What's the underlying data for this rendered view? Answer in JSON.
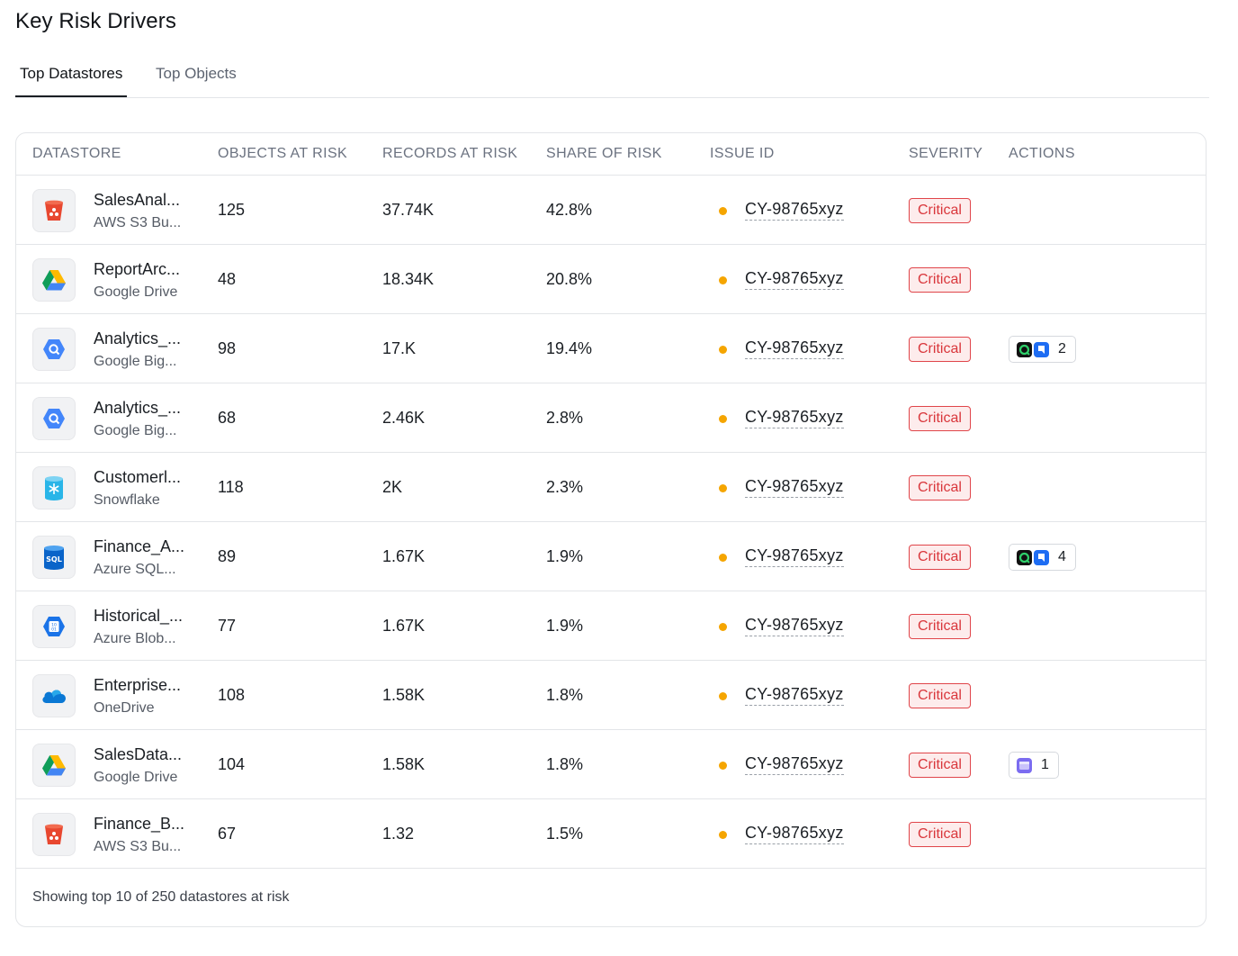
{
  "title": "Key Risk Drivers",
  "tabs": [
    {
      "label": "Top Datastores",
      "active": true
    },
    {
      "label": "Top Objects",
      "active": false
    }
  ],
  "columns": [
    "DATASTORE",
    "OBJECTS AT RISK",
    "RECORDS AT RISK",
    "SHARE OF RISK",
    "ISSUE ID",
    "SEVERITY",
    "ACTIONS"
  ],
  "rows": [
    {
      "name": "SalesAnal...",
      "type": "AWS S3 Bu...",
      "icon": "aws-s3-bucket-icon",
      "objects": "125",
      "records": "37.74K",
      "share": "42.8%",
      "issue": "CY-98765xyz",
      "severity": "Critical",
      "action": null
    },
    {
      "name": "ReportArc...",
      "type": "Google Drive",
      "icon": "google-drive-icon",
      "objects": "48",
      "records": "18.34K",
      "share": "20.8%",
      "issue": "CY-98765xyz",
      "severity": "Critical",
      "action": null
    },
    {
      "name": "Analytics_...",
      "type": "Google Big...",
      "icon": "google-bigquery-icon",
      "objects": "98",
      "records": "17.K",
      "share": "19.4%",
      "issue": "CY-98765xyz",
      "severity": "Critical",
      "action": {
        "kind": "dual",
        "count": "2"
      }
    },
    {
      "name": "Analytics_...",
      "type": "Google Big...",
      "icon": "google-bigquery-icon",
      "objects": "68",
      "records": "2.46K",
      "share": "2.8%",
      "issue": "CY-98765xyz",
      "severity": "Critical",
      "action": null
    },
    {
      "name": "Customerl...",
      "type": "Snowflake",
      "icon": "snowflake-icon",
      "objects": "118",
      "records": "2K",
      "share": "2.3%",
      "issue": "CY-98765xyz",
      "severity": "Critical",
      "action": null
    },
    {
      "name": "Finance_A...",
      "type": "Azure SQL...",
      "icon": "azure-sql-icon",
      "objects": "89",
      "records": "1.67K",
      "share": "1.9%",
      "issue": "CY-98765xyz",
      "severity": "Critical",
      "action": {
        "kind": "dual",
        "count": "4"
      }
    },
    {
      "name": "Historical_...",
      "type": "Azure Blob...",
      "icon": "azure-blob-icon",
      "objects": "77",
      "records": "1.67K",
      "share": "1.9%",
      "issue": "CY-98765xyz",
      "severity": "Critical",
      "action": null
    },
    {
      "name": "Enterprise...",
      "type": "OneDrive",
      "icon": "onedrive-icon",
      "objects": "108",
      "records": "1.58K",
      "share": "1.8%",
      "issue": "CY-98765xyz",
      "severity": "Critical",
      "action": null
    },
    {
      "name": "SalesData...",
      "type": "Google Drive",
      "icon": "google-drive-icon",
      "objects": "104",
      "records": "1.58K",
      "share": "1.8%",
      "issue": "CY-98765xyz",
      "severity": "Critical",
      "action": {
        "kind": "single",
        "count": "1"
      }
    },
    {
      "name": "Finance_B...",
      "type": "AWS S3 Bu...",
      "icon": "aws-s3-bucket-icon",
      "objects": "67",
      "records": "1.32",
      "share": "1.5%",
      "issue": "CY-98765xyz",
      "severity": "Critical",
      "action": null
    }
  ],
  "footer": "Showing top 10 of 250 datastores at risk",
  "colors": {
    "accent": "#1b1f24",
    "critical": "#d9363b",
    "critical_bg": "#fdecec",
    "dot": "#f5a500"
  }
}
